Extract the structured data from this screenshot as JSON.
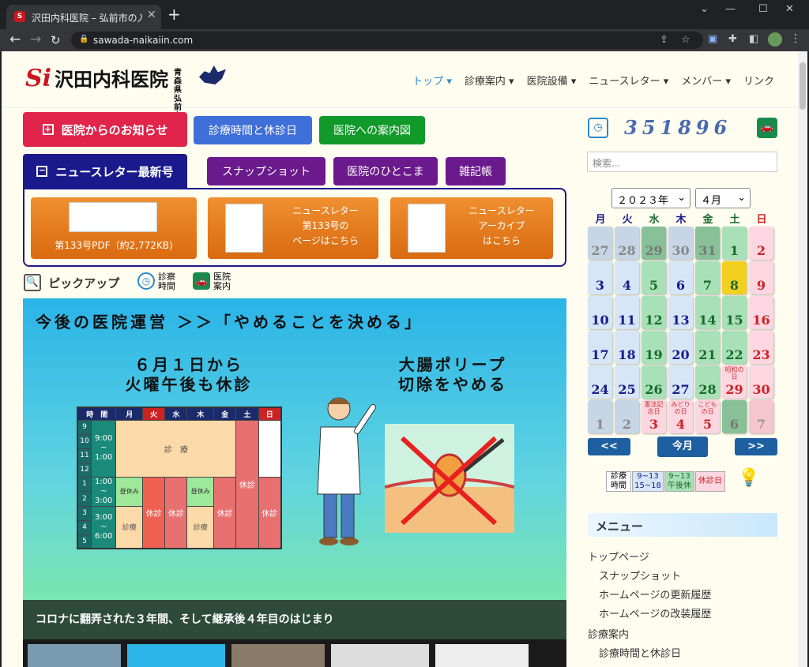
{
  "browser": {
    "tab_title": "沢田内科医院 – 弘前市の入院設備",
    "url": "sawada-naikaiin.com"
  },
  "header": {
    "logo_text": "沢田内科医院",
    "logo_sub1": "青森県",
    "logo_sub2": "弘前市",
    "nav": [
      "トップ",
      "診療案内",
      "医院設備",
      "ニュースレター",
      "メンバー",
      "リンク"
    ]
  },
  "buttons": {
    "notice": "医院からのお知らせ",
    "hours": "診療時間と休診日",
    "map": "医院への案内図",
    "newsletter": "ニュースレター最新号",
    "snapshot": "スナップショット",
    "hitokoma": "医院のひとこま",
    "notes": "雑記帳"
  },
  "news_cards": [
    {
      "line1": "第133号PDF（約2,772KB)"
    },
    {
      "line1": "ニュースレター",
      "line2": "第133号の",
      "line3": "ページはこちら"
    },
    {
      "line1": "ニュースレター",
      "line2": "アーカイブ",
      "line3": "はこちら"
    }
  ],
  "pickup": {
    "label": "ピックアップ",
    "hours1": "診察",
    "hours2": "時間",
    "guide1": "医院",
    "guide2": "案内"
  },
  "hero": {
    "headline": "今後の医院運営 ＞＞「やめることを決める」",
    "left_title1": "６月１日から",
    "left_title2": "火曜午後も休診",
    "right_title1": "大腸ポリープ",
    "right_title2": "切除をやめる",
    "table_headers": [
      "時　間",
      "月",
      "火",
      "水",
      "木",
      "金",
      "土",
      "日"
    ],
    "time1a": "9:00",
    "time1b": "~",
    "time1c": "1:00",
    "time2a": "1:00",
    "time2b": "~",
    "time2c": "3:00",
    "time3a": "3:00",
    "time3b": "~",
    "time3c": "6:00",
    "hours": [
      "9",
      "10",
      "11",
      "12",
      "1",
      "2",
      "3",
      "4",
      "5"
    ],
    "shinryo": "診　療",
    "kyushin": "休診",
    "hirukyu": "昼休み",
    "shinryo2": "診療"
  },
  "banner": "コロナに翻弄された３年間、そして継承後４年目のはじまり",
  "sidebar": {
    "counter": "351896",
    "search_placeholder": "検索...",
    "year": "２０２３年",
    "month": "４月",
    "dow": [
      "月",
      "火",
      "水",
      "木",
      "金",
      "土",
      "日"
    ],
    "prev": "<<",
    "today": "今月",
    "next": ">>",
    "legend_label1": "診療",
    "legend_label2": "時間",
    "legend_a1": "9~13",
    "legend_a2": "15~18",
    "legend_b1": "9~13",
    "legend_b2": "午後休",
    "legend_c": "休診日",
    "menu_title": "メニュー",
    "menu_items": [
      "トップページ",
      "スナップショット",
      "ホームページの更新履歴",
      "ホームページの改装履歴",
      "診療案内",
      "診療時間と休診日"
    ]
  },
  "calendar": [
    [
      "27",
      "28",
      "29",
      "30",
      "31",
      "1",
      "2"
    ],
    [
      "3",
      "4",
      "5",
      "6",
      "7",
      "8",
      "9"
    ],
    [
      "10",
      "11",
      "12",
      "13",
      "14",
      "15",
      "16"
    ],
    [
      "17",
      "18",
      "19",
      "20",
      "21",
      "22",
      "23"
    ],
    [
      "24",
      "25",
      "26",
      "27",
      "28",
      "29",
      "30"
    ],
    [
      "1",
      "2",
      "3",
      "4",
      "5",
      "6",
      "7"
    ]
  ],
  "holidays": {
    "h1": "昭和の日",
    "h2": "憲法記念日",
    "h3": "みどりの日",
    "h4": "こどもの日"
  }
}
